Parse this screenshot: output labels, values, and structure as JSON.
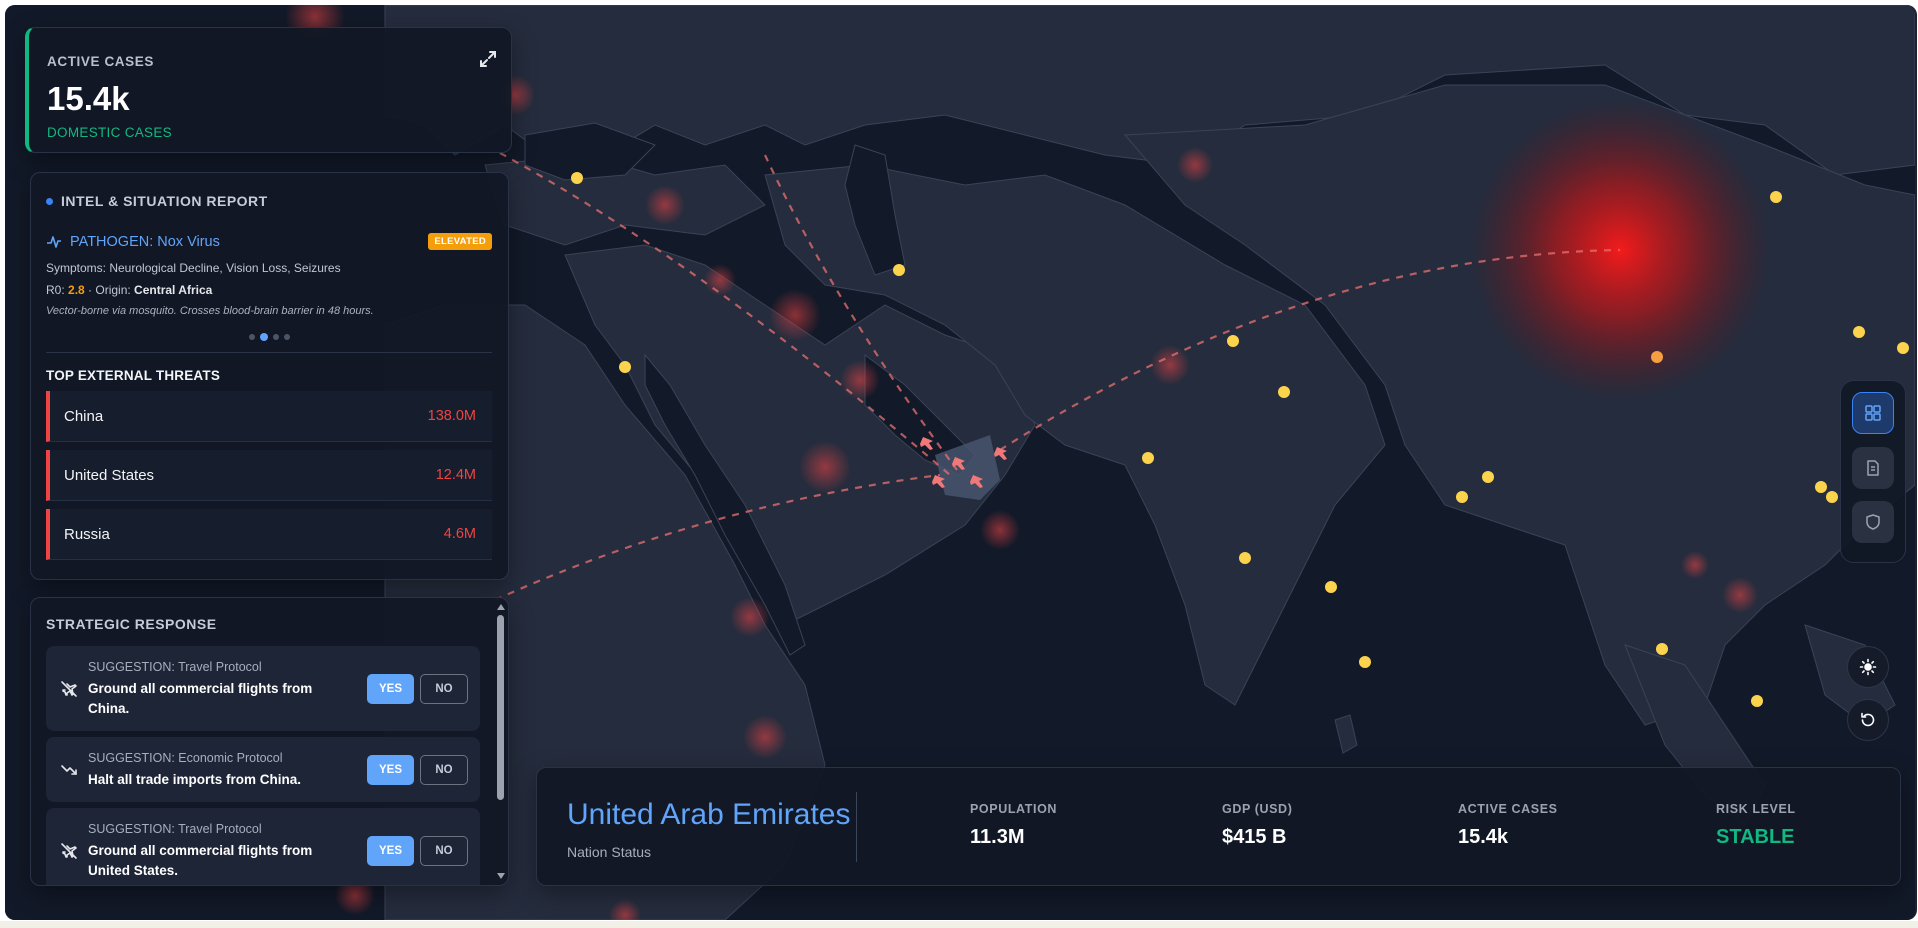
{
  "active_cases": {
    "label": "ACTIVE CASES",
    "value": "15.4k",
    "sub": "DOMESTIC CASES"
  },
  "intel": {
    "title": "INTEL & SITUATION REPORT",
    "pathogen_label": "PATHOGEN: Nox Virus",
    "badge": "ELEVATED",
    "symptoms": "Symptoms: Neurological Decline, Vision Loss, Seizures",
    "r0_prefix": "R0: ",
    "r0_value": "2.8",
    "origin_prefix": " · Origin: ",
    "origin": "Central Africa",
    "description": "Vector-borne via mosquito. Crosses blood-brain barrier in 48 hours.",
    "carousel_active_index": 1,
    "carousel_count": 4
  },
  "threats": {
    "title": "TOP EXTERNAL THREATS",
    "items": [
      {
        "name": "China",
        "value": "138.0M"
      },
      {
        "name": "United States",
        "value": "12.4M"
      },
      {
        "name": "Russia",
        "value": "4.6M"
      }
    ]
  },
  "strategic": {
    "title": "STRATEGIC RESPONSE",
    "cards": [
      {
        "icon": "plane-off-icon",
        "label": "SUGGESTION: Travel Protocol",
        "text": "Ground all commercial flights from China.",
        "yes": "YES",
        "no": "NO"
      },
      {
        "icon": "trending-down-icon",
        "label": "SUGGESTION: Economic Protocol",
        "text": "Halt all trade imports from China.",
        "yes": "YES",
        "no": "NO"
      },
      {
        "icon": "plane-off-icon",
        "label": "SUGGESTION: Travel Protocol",
        "text": "Ground all commercial flights from United States.",
        "yes": "YES",
        "no": "NO"
      }
    ]
  },
  "nation": {
    "name": "United Arab Emirates",
    "subtitle": "Nation Status",
    "stats": {
      "population": {
        "label": "POPULATION",
        "value": "11.3M"
      },
      "gdp": {
        "label": "GDP (USD)",
        "value": "$415 B"
      },
      "cases": {
        "label": "ACTIVE CASES",
        "value": "15.4k"
      },
      "risk": {
        "label": "RISK LEVEL",
        "value": "STABLE"
      }
    }
  },
  "dock": {
    "buttons": [
      "dashboard-icon",
      "report-icon",
      "shield-icon"
    ],
    "active": "dashboard-icon"
  },
  "controls": [
    "sun-icon",
    "reset-icon"
  ],
  "colors": {
    "accent_blue": "#60a5fa",
    "threat_red": "#ef4444",
    "stable_green": "#10b981",
    "elevated_amber": "#f59e0b",
    "city_yellow": "#fcd34d"
  }
}
